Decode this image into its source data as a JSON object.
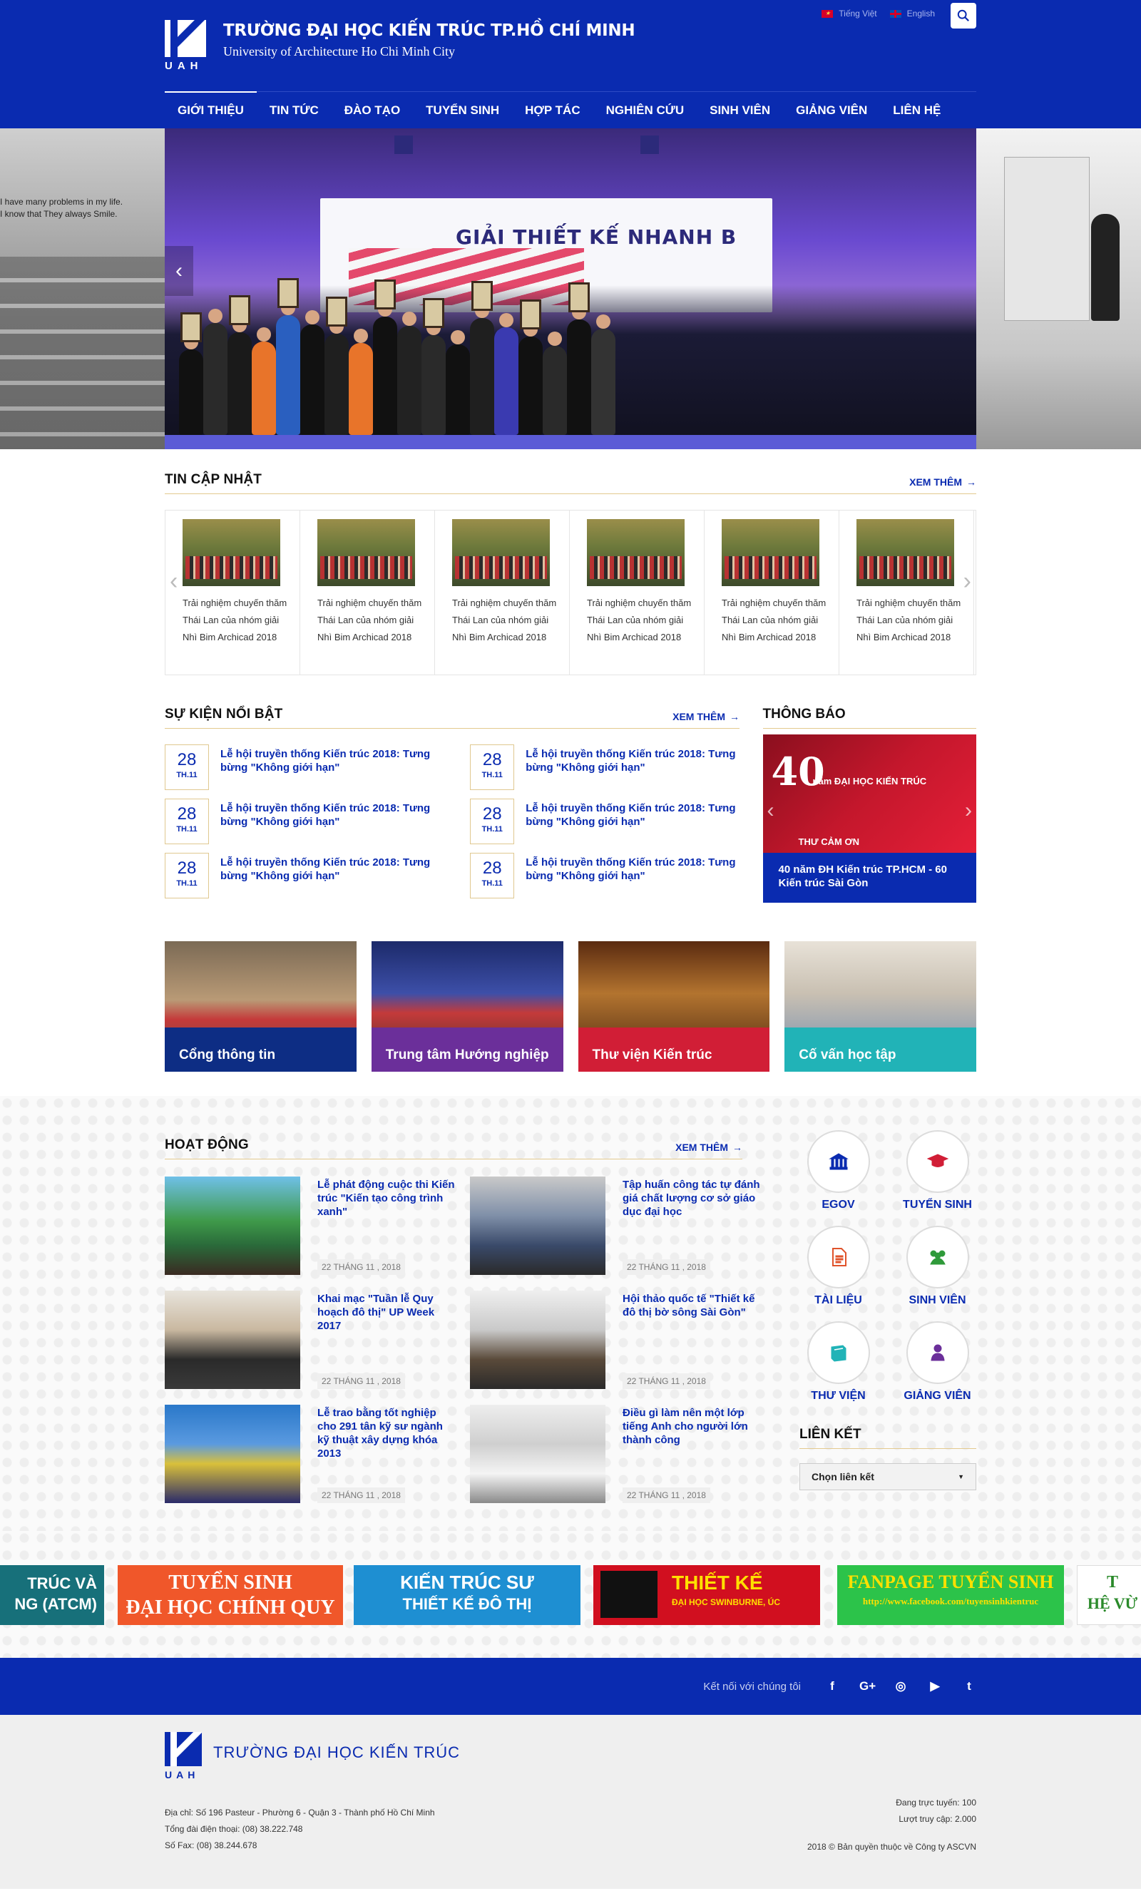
{
  "header": {
    "school_name": "TRƯỜNG ĐẠI HỌC KIẾN TRÚC TP.HỒ CHÍ MINH",
    "school_name_en": "University of Architecture Ho Chi Minh City",
    "logo_text": "UAH",
    "lang_vi": "Tiếng Việt",
    "lang_en": "English",
    "search_icon": "search-icon"
  },
  "nav": {
    "items": [
      "GIỚI THIỆU",
      "TIN TỨC",
      "ĐÀO TẠO",
      "TUYỂN SINH",
      "HỢP TÁC",
      "NGHIÊN CỨU",
      "SINH VIÊN",
      "GIẢNG VIÊN",
      "LIÊN HỆ"
    ],
    "active": "GIỚI THIỆU"
  },
  "hero": {
    "board_title": "GIẢI THIẾT KẾ NHANH B",
    "left_quote": [
      "I have many problems in my life.",
      "I know that They always Smile."
    ]
  },
  "news": {
    "title": "TIN CẬP NHẬT",
    "more": "XEM THÊM",
    "cards": [
      "Trải nghiệm chuyến thăm Thái Lan của nhóm giải Nhì Bim Archicad 2018",
      "Trải nghiệm chuyến thăm Thái Lan của nhóm giải Nhì Bim Archicad 2018",
      "Trải nghiệm chuyến thăm Thái Lan của nhóm giải Nhì Bim Archicad 2018",
      "Trải nghiệm chuyến thăm Thái Lan của nhóm giải Nhì Bim Archicad 2018",
      "Trải nghiệm chuyến thăm Thái Lan của nhóm giải Nhì Bim Archicad 2018",
      "Trải nghiệm chuyến thăm Thái Lan của nhóm giải Nhì Bim Archicad 2018"
    ]
  },
  "events": {
    "title": "SỰ KIỆN NỔI BẬT",
    "more": "XEM THÊM",
    "items": [
      {
        "day": "28",
        "month": "TH.11",
        "title": "Lễ hội truyền thống Kiến trúc 2018: Tưng bừng \"Không giới hạn\""
      },
      {
        "day": "28",
        "month": "TH.11",
        "title": "Lễ hội truyền thống Kiến trúc 2018: Tưng bừng \"Không giới hạn\""
      },
      {
        "day": "28",
        "month": "TH.11",
        "title": "Lễ hội truyền thống Kiến trúc 2018: Tưng bừng \"Không giới hạn\""
      },
      {
        "day": "28",
        "month": "TH.11",
        "title": "Lễ hội truyền thống Kiến trúc 2018: Tưng bừng \"Không giới hạn\""
      },
      {
        "day": "28",
        "month": "TH.11",
        "title": "Lễ hội truyền thống Kiến trúc 2018: Tưng bừng \"Không giới hạn\""
      },
      {
        "day": "28",
        "month": "TH.11",
        "title": "Lễ hội truyền thống Kiến trúc 2018: Tưng bừng \"Không giới hạn\""
      }
    ]
  },
  "notice": {
    "title": "THÔNG BÁO",
    "img_big": "40",
    "img_small": "năm ĐẠI HỌC KIẾN TRÚC",
    "img_thanks": "THƯ CẢM ƠN",
    "caption": "40 năm ĐH Kiến trúc TP.HCM - 60 Kiến trúc Sài Gòn"
  },
  "quick": [
    {
      "label": "Cổng thông tin",
      "color": "#0d2d84"
    },
    {
      "label": "Trung tâm Hướng nghiệp",
      "color": "#6b2f9a"
    },
    {
      "label": "Thư viện Kiến trúc",
      "color": "#d11e36"
    },
    {
      "label": "Cố vấn học tập",
      "color": "#21b3b7"
    }
  ],
  "activities": {
    "title": "HOẠT ĐỘNG",
    "more": "XEM THÊM",
    "items": [
      {
        "title": "Lễ phát động cuộc thi Kiến trúc \"Kiến tạo công trình xanh\"",
        "date": "22 THÁNG 11 , 2018"
      },
      {
        "title": "Tập huấn công tác tự đánh giá chất lượng cơ sở giáo dục đại học",
        "date": "22 THÁNG 11 , 2018"
      },
      {
        "title": "Khai mạc \"Tuần lễ Quy hoạch đô thị\" UP Week 2017",
        "date": "22 THÁNG 11 , 2018"
      },
      {
        "title": "Hội thảo quốc tế \"Thiết kế đô thị bờ sông Sài Gòn\"",
        "date": "22 THÁNG 11 , 2018"
      },
      {
        "title": "Lễ trao bằng tốt nghiệp cho 291 tân kỹ sư ngành kỹ thuật xây dựng khóa 2013",
        "date": "22 THÁNG 11 , 2018"
      },
      {
        "title": "Điều gì làm nên một lớp tiếng Anh cho người lớn thành công",
        "date": "22 THÁNG 11 , 2018"
      }
    ]
  },
  "icons": [
    {
      "label": "EGOV",
      "icon": "bank-icon",
      "color": "#0a2bb0"
    },
    {
      "label": "TUYỂN SINH",
      "icon": "graduation-cap-icon",
      "color": "#d11e36"
    },
    {
      "label": "TÀI LIỆU",
      "icon": "document-icon",
      "color": "#e0532b"
    },
    {
      "label": "SINH VIÊN",
      "icon": "users-icon",
      "color": "#2f9a3a"
    },
    {
      "label": "THƯ VIỆN",
      "icon": "book-icon",
      "color": "#21b3b7"
    },
    {
      "label": "GIẢNG VIÊN",
      "icon": "user-icon",
      "color": "#6b2f9a"
    }
  ],
  "links": {
    "title": "LIÊN KẾT",
    "select": "Chọn liên kết"
  },
  "banners": [
    {
      "line1": "TRÚC VÀ",
      "line2": "NG (ATCM)",
      "bg": "#17707a"
    },
    {
      "line1": "TUYỂN SINH",
      "line2": "ĐẠI HỌC CHÍNH QUY",
      "bg": "#f0572a"
    },
    {
      "line1": "KIẾN TRÚC SƯ",
      "line2": "THIẾT KẾ ĐÔ THỊ",
      "bg": "#1e8fd2"
    },
    {
      "line1": "THIẾT KẾ",
      "line2": "ĐẠI HỌC SWINBURNE, ÚC",
      "bg": "#d10f1f"
    },
    {
      "line1": "FANPAGE TUYỂN SINH",
      "line2": "http://www.facebook.com/tuyensinhkientruc",
      "bg": "#2cc34a"
    },
    {
      "line1": "T",
      "line2": "HỆ VỪ",
      "bg": "#ffffff"
    }
  ],
  "footer_bar": {
    "label": "Kết nối với chúng tôi",
    "social": [
      "f",
      "G+",
      "◎",
      "▶",
      "t"
    ]
  },
  "footer": {
    "logo_text": "UAH",
    "name": "TRƯỜNG ĐẠI HỌC KIẾN TRÚC",
    "address": "Địa chỉ: Số 196 Pasteur - Phường 6 - Quận 3 - Thành phố Hồ Chí Minh",
    "phone": "Tổng đài điện thoại: (08) 38.222.748",
    "fax": "Số Fax: (08) 38.244.678",
    "online": "Đang trực tuyến: 100",
    "visits": "Lượt truy cập: 2.000",
    "copyright": "2018 © Bản quyền thuộc về Công ty ASCVN"
  }
}
